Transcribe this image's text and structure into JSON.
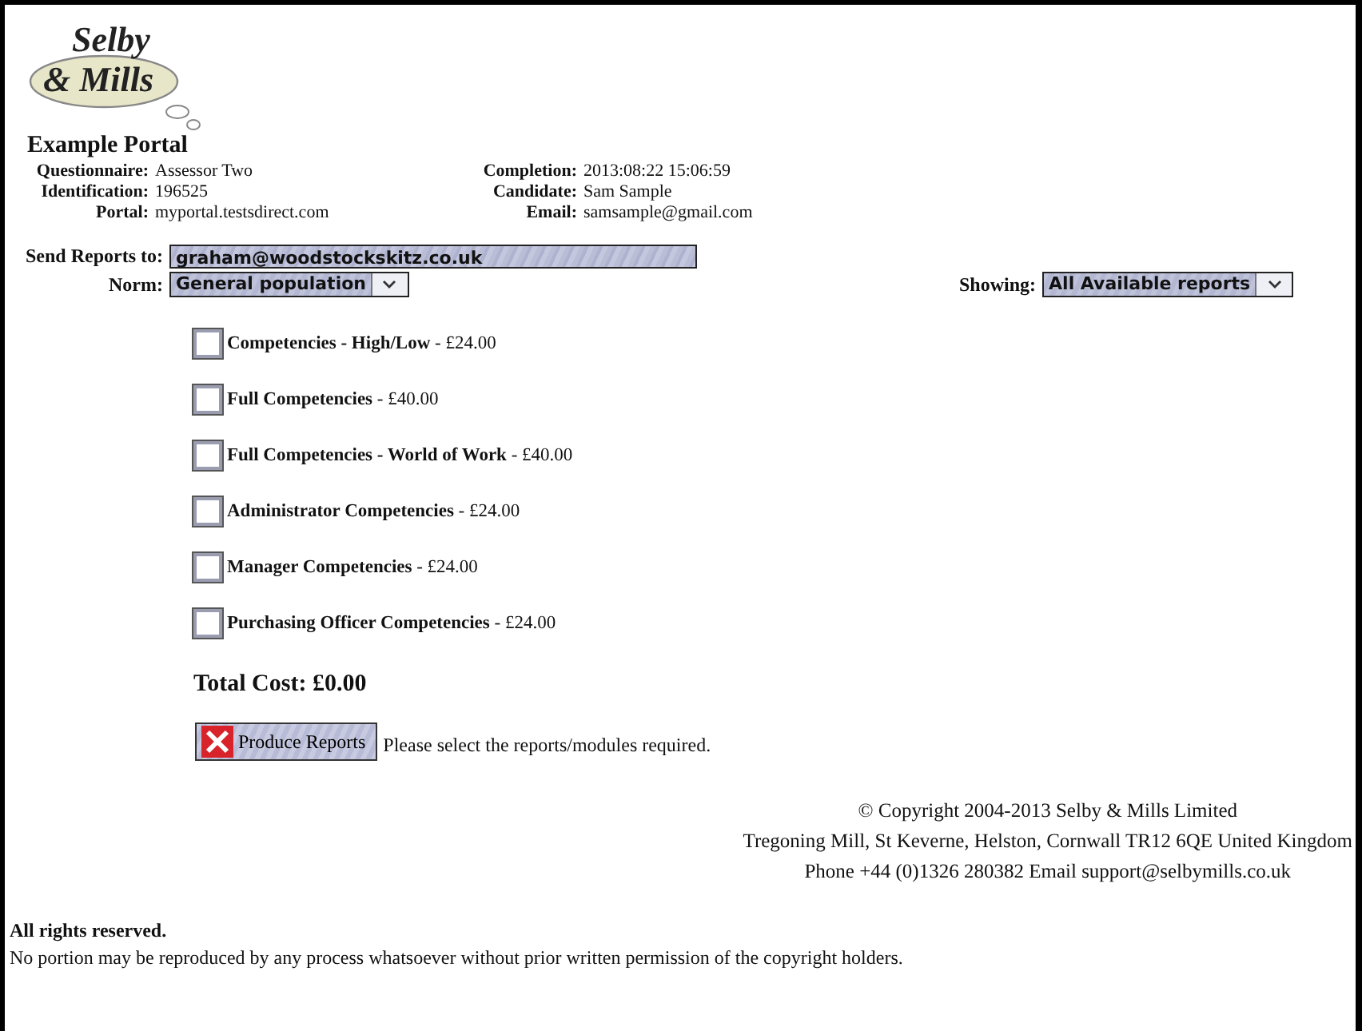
{
  "logo": {
    "line_1": "Selby",
    "line_2": "& Mills"
  },
  "portal_title": "Example Portal",
  "details": [
    {
      "label": "Questionnaire:",
      "value": "Assessor Two"
    },
    {
      "label": "Completion:",
      "value": "2013:08:22 15:06:59"
    },
    {
      "label": "Identification:",
      "value": "196525"
    },
    {
      "label": "Candidate:",
      "value": "Sam Sample"
    },
    {
      "label": "Portal:",
      "value": "myportal.testsdirect.com"
    },
    {
      "label": "Email:",
      "value": "samsample@gmail.com"
    }
  ],
  "send_reports": {
    "label": "Send Reports to:",
    "value": "graham@woodstockskitz.co.uk"
  },
  "norm": {
    "label": "Norm:",
    "value": "General population"
  },
  "showing": {
    "label": "Showing:",
    "value": "All Available reports"
  },
  "reports": [
    {
      "text": "**Competencies - High/Low** - £24.00",
      "checked": false
    },
    {
      "text": "**Full Competencies** - £40.00",
      "checked": false
    },
    {
      "text": "**Full Competencies - World of Work** - £40.00",
      "checked": false
    },
    {
      "text": "**Administrator Competencies** - £24.00",
      "checked": false
    },
    {
      "text": "**Manager Competencies** - £24.00",
      "checked": false
    },
    {
      "text": "**Purchasing Officer Competencies** - £24.00",
      "checked": false
    }
  ],
  "total_cost": "Total Cost: £0.00",
  "produce_button": {
    "label": "Produce Reports",
    "disabled": true
  },
  "status_message": "Please select the reports/modules required.",
  "footer": [
    "© Copyright 2004-2013 Selby & Mills Limited",
    "Tregoning Mill, St Keverne, Helston, Cornwall TR12 6QE United Kingdom",
    "Phone +44 (0)1326 280382 Email support@selbymills.co.uk"
  ],
  "rights_title": "All rights reserved.",
  "rights_text": "No portion may be reproduced by any process whatsoever without prior written permission of the copyright holders."
}
